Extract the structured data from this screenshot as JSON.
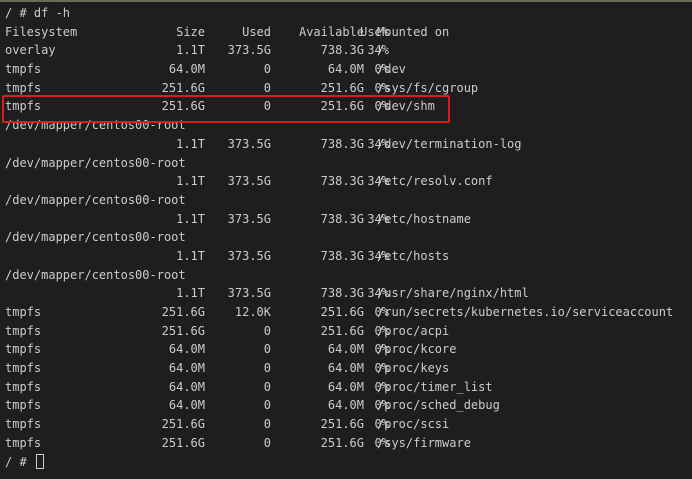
{
  "terminal": {
    "command": "/ # df -h",
    "header": {
      "filesystem": "Filesystem",
      "size": "Size",
      "used": "Used",
      "available": "Available",
      "use_pct": "Use%",
      "mounted_on": "Mounted on"
    },
    "rows": [
      {
        "filesystem": "overlay",
        "size": "1.1T",
        "used": "373.5G",
        "available": "738.3G",
        "use_pct": "34%",
        "mounted_on": "/"
      },
      {
        "filesystem": "tmpfs",
        "size": "64.0M",
        "used": "0",
        "available": "64.0M",
        "use_pct": "0%",
        "mounted_on": "/dev"
      },
      {
        "filesystem": "tmpfs",
        "size": "251.6G",
        "used": "0",
        "available": "251.6G",
        "use_pct": "0%",
        "mounted_on": "/sys/fs/cgroup"
      },
      {
        "filesystem": "tmpfs",
        "size": "251.6G",
        "used": "0",
        "available": "251.6G",
        "use_pct": "0%",
        "mounted_on": "/dev/shm",
        "highlighted": true
      },
      {
        "filesystem": "/dev/mapper/centos00-root",
        "size": "",
        "used": "",
        "available": "",
        "use_pct": "",
        "mounted_on": ""
      },
      {
        "filesystem": "",
        "size": "1.1T",
        "used": "373.5G",
        "available": "738.3G",
        "use_pct": "34%",
        "mounted_on": "/dev/termination-log"
      },
      {
        "filesystem": "/dev/mapper/centos00-root",
        "size": "",
        "used": "",
        "available": "",
        "use_pct": "",
        "mounted_on": ""
      },
      {
        "filesystem": "",
        "size": "1.1T",
        "used": "373.5G",
        "available": "738.3G",
        "use_pct": "34%",
        "mounted_on": "/etc/resolv.conf"
      },
      {
        "filesystem": "/dev/mapper/centos00-root",
        "size": "",
        "used": "",
        "available": "",
        "use_pct": "",
        "mounted_on": ""
      },
      {
        "filesystem": "",
        "size": "1.1T",
        "used": "373.5G",
        "available": "738.3G",
        "use_pct": "34%",
        "mounted_on": "/etc/hostname"
      },
      {
        "filesystem": "/dev/mapper/centos00-root",
        "size": "",
        "used": "",
        "available": "",
        "use_pct": "",
        "mounted_on": ""
      },
      {
        "filesystem": "",
        "size": "1.1T",
        "used": "373.5G",
        "available": "738.3G",
        "use_pct": "34%",
        "mounted_on": "/etc/hosts"
      },
      {
        "filesystem": "/dev/mapper/centos00-root",
        "size": "",
        "used": "",
        "available": "",
        "use_pct": "",
        "mounted_on": ""
      },
      {
        "filesystem": "",
        "size": "1.1T",
        "used": "373.5G",
        "available": "738.3G",
        "use_pct": "34%",
        "mounted_on": "/usr/share/nginx/html"
      },
      {
        "filesystem": "tmpfs",
        "size": "251.6G",
        "used": "12.0K",
        "available": "251.6G",
        "use_pct": "0%",
        "mounted_on": "/run/secrets/kubernetes.io/serviceaccount"
      },
      {
        "filesystem": "tmpfs",
        "size": "251.6G",
        "used": "0",
        "available": "251.6G",
        "use_pct": "0%",
        "mounted_on": "/proc/acpi"
      },
      {
        "filesystem": "tmpfs",
        "size": "64.0M",
        "used": "0",
        "available": "64.0M",
        "use_pct": "0%",
        "mounted_on": "/proc/kcore"
      },
      {
        "filesystem": "tmpfs",
        "size": "64.0M",
        "used": "0",
        "available": "64.0M",
        "use_pct": "0%",
        "mounted_on": "/proc/keys"
      },
      {
        "filesystem": "tmpfs",
        "size": "64.0M",
        "used": "0",
        "available": "64.0M",
        "use_pct": "0%",
        "mounted_on": "/proc/timer_list"
      },
      {
        "filesystem": "tmpfs",
        "size": "64.0M",
        "used": "0",
        "available": "64.0M",
        "use_pct": "0%",
        "mounted_on": "/proc/sched_debug"
      },
      {
        "filesystem": "tmpfs",
        "size": "251.6G",
        "used": "0",
        "available": "251.6G",
        "use_pct": "0%",
        "mounted_on": "/proc/scsi"
      },
      {
        "filesystem": "tmpfs",
        "size": "251.6G",
        "used": "0",
        "available": "251.6G",
        "use_pct": "0%",
        "mounted_on": "/sys/firmware"
      }
    ],
    "prompt": "/ #",
    "colors": {
      "background": "#1e1e1e",
      "text": "#cccccc",
      "highlight_border": "#e0191f"
    }
  }
}
